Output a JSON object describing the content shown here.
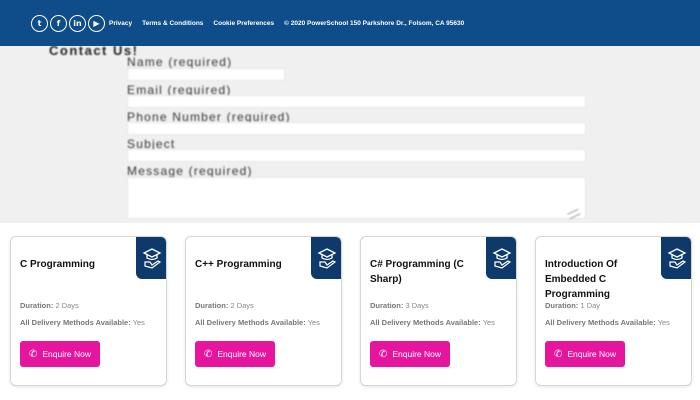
{
  "header": {
    "social": [
      {
        "icon": "twitter-icon",
        "glyph": "t"
      },
      {
        "icon": "facebook-icon",
        "glyph": "f"
      },
      {
        "icon": "linkedin-icon",
        "glyph": "in"
      },
      {
        "icon": "youtube-icon",
        "glyph": "▶"
      }
    ],
    "links": [
      "Privacy",
      "Terms & Conditions",
      "Cookie Preferences"
    ],
    "copyright": "© 2020 PowerSchool 150 Parkshore Dr., Folsom, CA 95630",
    "bg_color": "#0e4c8a"
  },
  "contact": {
    "title": "Contact Us!",
    "fields": {
      "name": "Name (required)",
      "email": "Email (required)",
      "phone": "Phone Number (required)",
      "subject": "Subject",
      "message": "Message (required)"
    }
  },
  "courses": [
    {
      "title": "C Programming",
      "duration_label": "Duration:",
      "duration": "2 Days",
      "delivery_label": "All Delivery Methods Available:",
      "delivery": "Yes",
      "button": "Enquire Now"
    },
    {
      "title": "C++ Programming",
      "duration_label": "Duration:",
      "duration": "2 Days",
      "delivery_label": "All Delivery Methods Available:",
      "delivery": "Yes",
      "button": "Enquire Now"
    },
    {
      "title": "C# Programming (C Sharp)",
      "duration_label": "Duration:",
      "duration": "3 Days",
      "delivery_label": "All Delivery Methods Available:",
      "delivery": "Yes",
      "button": "Enquire Now"
    },
    {
      "title": "Introduction Of Embedded C Programming",
      "duration_label": "Duration:",
      "duration": "1 Day",
      "delivery_label": "All Delivery Methods Available:",
      "delivery": "Yes",
      "button": "Enquire Now"
    }
  ],
  "colors": {
    "accent": "#e6159d",
    "badge": "#0e3a6b"
  }
}
